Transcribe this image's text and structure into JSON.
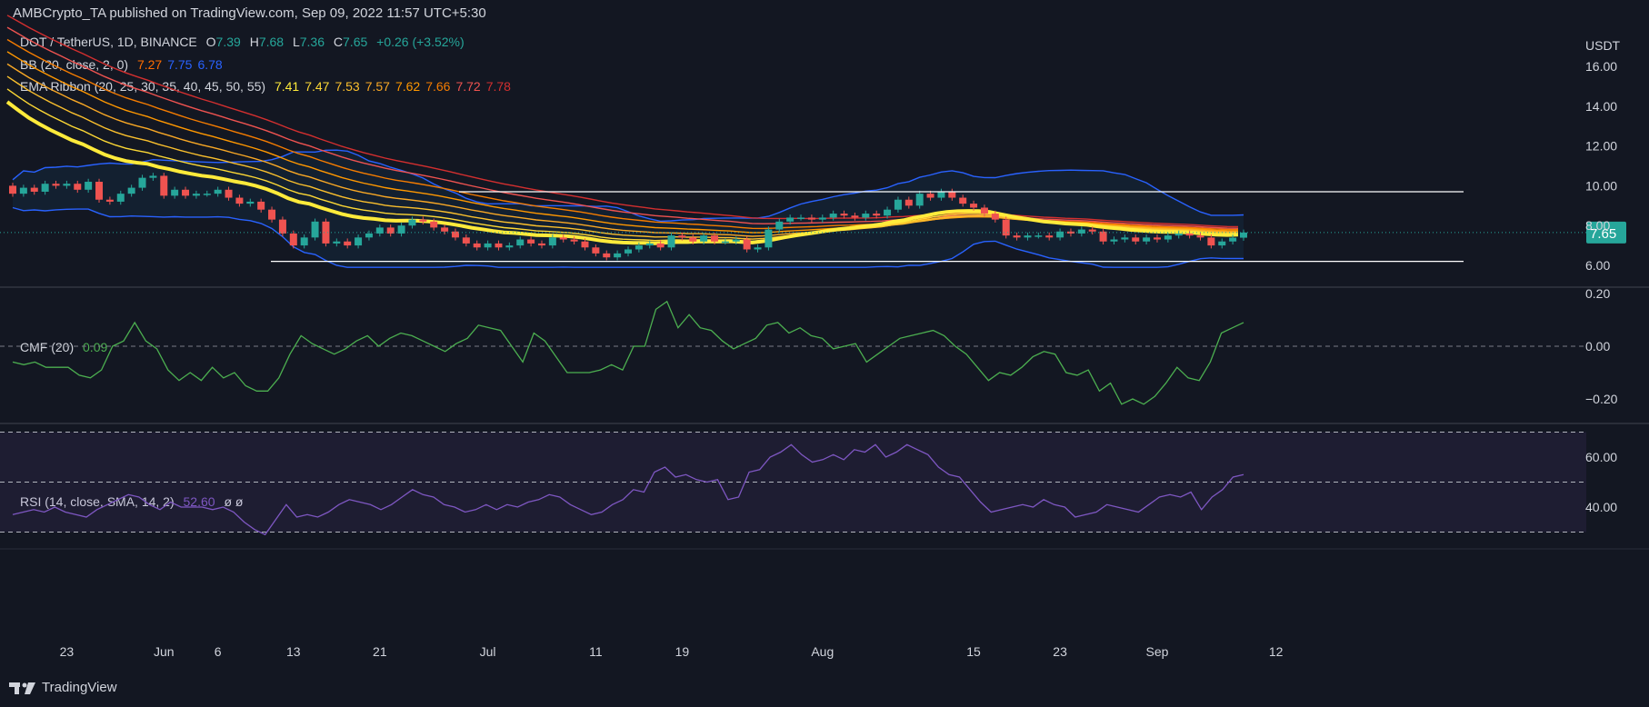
{
  "header": {
    "publisher": "AMBCrypto_TA published on TradingView.com, Sep 09, 2022 11:57 UTC+5:30"
  },
  "legend": {
    "symbol": "DOT / TetherUS, 1D, BINANCE",
    "ohlc": {
      "o_label": "O",
      "o": "7.39",
      "h_label": "H",
      "h": "7.68",
      "l_label": "L",
      "l": "7.36",
      "c_label": "C",
      "c": "7.65",
      "change": "+0.26 (+3.52%)"
    },
    "bb": {
      "label": "BB (20, close, 2, 0)",
      "values": [
        "7.27",
        "7.75",
        "6.78"
      ],
      "colors": [
        "#ff6d00",
        "#2962ff",
        "#2962ff"
      ]
    },
    "ema": {
      "label": "EMA Ribbon (20, 25, 30, 35, 40, 45, 50, 55)",
      "values": [
        "7.41",
        "7.47",
        "7.53",
        "7.57",
        "7.62",
        "7.66",
        "7.72",
        "7.78"
      ],
      "colors": [
        "#ffeb3b",
        "#fdd835",
        "#fbc02d",
        "#f9a825",
        "#ff9800",
        "#f57c00",
        "#ef5350",
        "#d32f2f"
      ]
    },
    "cmf": {
      "label": "CMF (20)",
      "value": "0.09",
      "color": "#4caf50"
    },
    "rsi": {
      "label": "RSI (14, close, SMA, 14, 2)",
      "value": "52.60",
      "extra": "ø ø",
      "color": "#7e57c2"
    }
  },
  "axis": {
    "currency": "USDT",
    "price_ticks": [
      "16.00",
      "14.00",
      "12.00",
      "10.00",
      "8.00",
      "6.00"
    ],
    "price_tick_values": [
      16,
      14,
      12,
      10,
      8,
      6
    ],
    "current_price": "7.65",
    "cmf_ticks": [
      "0.20",
      "0.00",
      "−0.20"
    ],
    "rsi_ticks": [
      "60.00",
      "40.00"
    ],
    "x_ticks": [
      "23",
      "Jun",
      "6",
      "13",
      "21",
      "Jul",
      "11",
      "19",
      "Aug",
      "15",
      "23",
      "Sep",
      "12"
    ]
  },
  "footer": {
    "brand": "TradingView"
  },
  "colors": {
    "bg": "#131722",
    "up": "#26a69a",
    "down": "#ef5350",
    "bb": "#2962ff",
    "cmf": "#4caf50",
    "rsi": "#7e57c2",
    "range": "#ffffff"
  },
  "chart_data": {
    "type": "candlestick",
    "title": "DOT / TetherUS, 1D, BINANCE",
    "ylabel": "USDT",
    "ylim": [
      5.5,
      17
    ],
    "x_start": "2022-05-18",
    "x_end": "2022-09-09",
    "candles": [
      {
        "d": "2022-05-18",
        "o": 10.0,
        "c": 9.6
      },
      {
        "d": "2022-05-19",
        "o": 9.6,
        "c": 9.9
      },
      {
        "d": "2022-05-20",
        "o": 9.9,
        "c": 9.7
      },
      {
        "d": "2022-05-21",
        "o": 9.7,
        "c": 10.1
      },
      {
        "d": "2022-05-22",
        "o": 10.1,
        "c": 10.0
      },
      {
        "d": "2022-05-23",
        "o": 10.0,
        "c": 10.1
      },
      {
        "d": "2022-05-24",
        "o": 10.1,
        "c": 9.8
      },
      {
        "d": "2022-05-25",
        "o": 9.8,
        "c": 10.2
      },
      {
        "d": "2022-05-26",
        "o": 10.2,
        "c": 9.3
      },
      {
        "d": "2022-05-27",
        "o": 9.3,
        "c": 9.2
      },
      {
        "d": "2022-05-28",
        "o": 9.2,
        "c": 9.6
      },
      {
        "d": "2022-05-29",
        "o": 9.6,
        "c": 9.9
      },
      {
        "d": "2022-05-30",
        "o": 9.9,
        "c": 10.4
      },
      {
        "d": "2022-05-31",
        "o": 10.4,
        "c": 10.5
      },
      {
        "d": "2022-06-01",
        "o": 10.5,
        "c": 9.5
      },
      {
        "d": "2022-06-02",
        "o": 9.5,
        "c": 9.8
      },
      {
        "d": "2022-06-03",
        "o": 9.8,
        "c": 9.5
      },
      {
        "d": "2022-06-04",
        "o": 9.5,
        "c": 9.6
      },
      {
        "d": "2022-06-05",
        "o": 9.6,
        "c": 9.6
      },
      {
        "d": "2022-06-06",
        "o": 9.6,
        "c": 9.8
      },
      {
        "d": "2022-06-07",
        "o": 9.8,
        "c": 9.4
      },
      {
        "d": "2022-06-08",
        "o": 9.4,
        "c": 9.1
      },
      {
        "d": "2022-06-09",
        "o": 9.1,
        "c": 9.2
      },
      {
        "d": "2022-06-10",
        "o": 9.2,
        "c": 8.8
      },
      {
        "d": "2022-06-11",
        "o": 8.8,
        "c": 8.3
      },
      {
        "d": "2022-06-12",
        "o": 8.3,
        "c": 7.6
      },
      {
        "d": "2022-06-13",
        "o": 7.6,
        "c": 7.0
      },
      {
        "d": "2022-06-14",
        "o": 7.0,
        "c": 7.4
      },
      {
        "d": "2022-06-15",
        "o": 7.4,
        "c": 8.2
      },
      {
        "d": "2022-06-16",
        "o": 8.2,
        "c": 7.1
      },
      {
        "d": "2022-06-17",
        "o": 7.1,
        "c": 7.2
      },
      {
        "d": "2022-06-18",
        "o": 7.2,
        "c": 7.0
      },
      {
        "d": "2022-06-19",
        "o": 7.0,
        "c": 7.4
      },
      {
        "d": "2022-06-20",
        "o": 7.4,
        "c": 7.6
      },
      {
        "d": "2022-06-21",
        "o": 7.6,
        "c": 7.9
      },
      {
        "d": "2022-06-22",
        "o": 7.9,
        "c": 7.6
      },
      {
        "d": "2022-06-23",
        "o": 7.6,
        "c": 8.0
      },
      {
        "d": "2022-06-24",
        "o": 8.0,
        "c": 8.3
      },
      {
        "d": "2022-06-25",
        "o": 8.3,
        "c": 8.2
      },
      {
        "d": "2022-06-26",
        "o": 8.2,
        "c": 7.9
      },
      {
        "d": "2022-06-27",
        "o": 7.9,
        "c": 7.7
      },
      {
        "d": "2022-06-28",
        "o": 7.7,
        "c": 7.4
      },
      {
        "d": "2022-06-29",
        "o": 7.4,
        "c": 7.1
      },
      {
        "d": "2022-06-30",
        "o": 7.1,
        "c": 6.9
      },
      {
        "d": "2022-07-01",
        "o": 6.9,
        "c": 7.1
      },
      {
        "d": "2022-07-02",
        "o": 7.1,
        "c": 6.9
      },
      {
        "d": "2022-07-03",
        "o": 6.9,
        "c": 7.0
      },
      {
        "d": "2022-07-04",
        "o": 7.0,
        "c": 7.3
      },
      {
        "d": "2022-07-05",
        "o": 7.3,
        "c": 7.1
      },
      {
        "d": "2022-07-06",
        "o": 7.1,
        "c": 7.0
      },
      {
        "d": "2022-07-07",
        "o": 7.0,
        "c": 7.4
      },
      {
        "d": "2022-07-08",
        "o": 7.4,
        "c": 7.3
      },
      {
        "d": "2022-07-09",
        "o": 7.3,
        "c": 7.2
      },
      {
        "d": "2022-07-10",
        "o": 7.2,
        "c": 6.9
      },
      {
        "d": "2022-07-11",
        "o": 6.9,
        "c": 6.6
      },
      {
        "d": "2022-07-12",
        "o": 6.6,
        "c": 6.4
      },
      {
        "d": "2022-07-13",
        "o": 6.4,
        "c": 6.6
      },
      {
        "d": "2022-07-14",
        "o": 6.6,
        "c": 6.8
      },
      {
        "d": "2022-07-15",
        "o": 6.8,
        "c": 7.0
      },
      {
        "d": "2022-07-16",
        "o": 7.0,
        "c": 7.1
      },
      {
        "d": "2022-07-17",
        "o": 7.1,
        "c": 6.9
      },
      {
        "d": "2022-07-18",
        "o": 6.9,
        "c": 7.5
      },
      {
        "d": "2022-07-19",
        "o": 7.5,
        "c": 7.4
      },
      {
        "d": "2022-07-20",
        "o": 7.4,
        "c": 7.2
      },
      {
        "d": "2022-07-21",
        "o": 7.2,
        "c": 7.5
      },
      {
        "d": "2022-07-22",
        "o": 7.5,
        "c": 7.2
      },
      {
        "d": "2022-07-23",
        "o": 7.2,
        "c": 7.2
      },
      {
        "d": "2022-07-24",
        "o": 7.2,
        "c": 7.3
      },
      {
        "d": "2022-07-25",
        "o": 7.3,
        "c": 6.8
      },
      {
        "d": "2022-07-26",
        "o": 6.8,
        "c": 6.9
      },
      {
        "d": "2022-07-27",
        "o": 6.9,
        "c": 7.8
      },
      {
        "d": "2022-07-28",
        "o": 7.8,
        "c": 8.2
      },
      {
        "d": "2022-07-29",
        "o": 8.2,
        "c": 8.4
      },
      {
        "d": "2022-07-30",
        "o": 8.4,
        "c": 8.4
      },
      {
        "d": "2022-07-31",
        "o": 8.4,
        "c": 8.3
      },
      {
        "d": "2022-08-01",
        "o": 8.3,
        "c": 8.4
      },
      {
        "d": "2022-08-02",
        "o": 8.4,
        "c": 8.6
      },
      {
        "d": "2022-08-03",
        "o": 8.6,
        "c": 8.5
      },
      {
        "d": "2022-08-04",
        "o": 8.5,
        "c": 8.4
      },
      {
        "d": "2022-08-05",
        "o": 8.4,
        "c": 8.6
      },
      {
        "d": "2022-08-06",
        "o": 8.6,
        "c": 8.5
      },
      {
        "d": "2022-08-07",
        "o": 8.5,
        "c": 8.8
      },
      {
        "d": "2022-08-08",
        "o": 8.8,
        "c": 9.3
      },
      {
        "d": "2022-08-09",
        "o": 9.3,
        "c": 9.0
      },
      {
        "d": "2022-08-10",
        "o": 9.0,
        "c": 9.6
      },
      {
        "d": "2022-08-11",
        "o": 9.6,
        "c": 9.4
      },
      {
        "d": "2022-08-12",
        "o": 9.4,
        "c": 9.7
      },
      {
        "d": "2022-08-13",
        "o": 9.7,
        "c": 9.4
      },
      {
        "d": "2022-08-14",
        "o": 9.4,
        "c": 9.1
      },
      {
        "d": "2022-08-15",
        "o": 9.1,
        "c": 8.9
      },
      {
        "d": "2022-08-16",
        "o": 8.9,
        "c": 8.6
      },
      {
        "d": "2022-08-17",
        "o": 8.6,
        "c": 8.3
      },
      {
        "d": "2022-08-18",
        "o": 8.3,
        "c": 7.5
      },
      {
        "d": "2022-08-19",
        "o": 7.5,
        "c": 7.4
      },
      {
        "d": "2022-08-20",
        "o": 7.4,
        "c": 7.5
      },
      {
        "d": "2022-08-21",
        "o": 7.5,
        "c": 7.5
      },
      {
        "d": "2022-08-22",
        "o": 7.5,
        "c": 7.4
      },
      {
        "d": "2022-08-23",
        "o": 7.4,
        "c": 7.7
      },
      {
        "d": "2022-08-24",
        "o": 7.7,
        "c": 7.6
      },
      {
        "d": "2022-08-25",
        "o": 7.6,
        "c": 7.8
      },
      {
        "d": "2022-08-26",
        "o": 7.8,
        "c": 7.7
      },
      {
        "d": "2022-08-27",
        "o": 7.7,
        "c": 7.2
      },
      {
        "d": "2022-08-28",
        "o": 7.2,
        "c": 7.3
      },
      {
        "d": "2022-08-29",
        "o": 7.3,
        "c": 7.4
      },
      {
        "d": "2022-08-30",
        "o": 7.4,
        "c": 7.2
      },
      {
        "d": "2022-08-31",
        "o": 7.2,
        "c": 7.4
      },
      {
        "d": "2022-09-01",
        "o": 7.4,
        "c": 7.3
      },
      {
        "d": "2022-09-02",
        "o": 7.3,
        "c": 7.5
      },
      {
        "d": "2022-09-03",
        "o": 7.5,
        "c": 7.6
      },
      {
        "d": "2022-09-04",
        "o": 7.6,
        "c": 7.5
      },
      {
        "d": "2022-09-05",
        "o": 7.5,
        "c": 7.4
      },
      {
        "d": "2022-09-06",
        "o": 7.4,
        "c": 7.0
      },
      {
        "d": "2022-09-07",
        "o": 7.0,
        "c": 7.2
      },
      {
        "d": "2022-09-08",
        "o": 7.2,
        "c": 7.39
      },
      {
        "d": "2022-09-09",
        "o": 7.39,
        "c": 7.65
      }
    ],
    "range_lines": [
      {
        "name": "resistance",
        "value": 9.7
      },
      {
        "name": "support",
        "value": 6.2
      }
    ],
    "cmf": {
      "ylim": [
        -0.28,
        0.24
      ],
      "values": [
        -0.06,
        -0.07,
        -0.06,
        -0.08,
        -0.08,
        -0.08,
        -0.11,
        -0.12,
        -0.09,
        0.0,
        0.02,
        0.09,
        0.02,
        -0.01,
        -0.09,
        -0.13,
        -0.1,
        -0.13,
        -0.08,
        -0.12,
        -0.1,
        -0.15,
        -0.17,
        -0.17,
        -0.12,
        -0.03,
        0.04,
        0.01,
        -0.01,
        -0.03,
        -0.01,
        0.02,
        0.04,
        0.0,
        0.03,
        0.05,
        0.04,
        0.02,
        0.0,
        -0.02,
        0.01,
        0.03,
        0.08,
        0.07,
        0.06,
        0.0,
        -0.06,
        0.05,
        0.02,
        -0.04,
        -0.1,
        -0.1,
        -0.1,
        -0.09,
        -0.07,
        -0.09,
        0.0,
        0.0,
        0.14,
        0.17,
        0.07,
        0.12,
        0.07,
        0.06,
        0.02,
        -0.01,
        0.01,
        0.03,
        0.08,
        0.09,
        0.05,
        0.07,
        0.04,
        0.03,
        -0.01,
        0.0,
        0.01,
        -0.06,
        -0.03,
        0.0,
        0.03,
        0.04,
        0.05,
        0.06,
        0.04,
        0.0,
        -0.03,
        -0.08,
        -0.13,
        -0.1,
        -0.11,
        -0.08,
        -0.04,
        -0.02,
        -0.03,
        -0.1,
        -0.11,
        -0.09,
        -0.17,
        -0.14,
        -0.22,
        -0.2,
        -0.22,
        -0.19,
        -0.14,
        -0.08,
        -0.12,
        -0.13,
        -0.06,
        0.05,
        0.07,
        0.09
      ]
    },
    "rsi": {
      "ylim": [
        28,
        72
      ],
      "bands": [
        70,
        50,
        30
      ],
      "values": [
        37,
        38,
        39,
        38,
        40,
        38,
        37,
        36,
        39,
        41,
        43,
        45,
        44,
        41,
        39,
        42,
        40,
        40,
        40,
        39,
        40,
        38,
        34,
        31,
        29,
        35,
        41,
        36,
        37,
        36,
        38,
        41,
        43,
        42,
        41,
        39,
        41,
        44,
        47,
        45,
        44,
        41,
        40,
        38,
        39,
        41,
        39,
        41,
        40,
        42,
        43,
        45,
        44,
        41,
        39,
        37,
        38,
        41,
        43,
        47,
        46,
        54,
        56,
        52,
        53,
        51,
        50,
        51,
        43,
        44,
        54,
        55,
        60,
        62,
        65,
        61,
        58,
        59,
        61,
        59,
        63,
        62,
        65,
        60,
        62,
        65,
        63,
        61,
        56,
        53,
        52,
        47,
        42,
        38,
        39,
        40,
        41,
        40,
        43,
        41,
        40,
        36,
        37,
        38,
        41,
        40,
        39,
        38,
        41,
        44,
        45,
        44,
        46,
        39,
        44,
        47,
        52,
        53
      ]
    }
  }
}
